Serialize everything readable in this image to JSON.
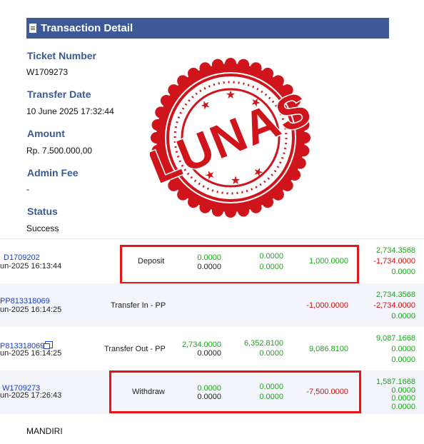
{
  "detail": {
    "title": "Transaction Detail",
    "ticket_label": "Ticket Number",
    "ticket_value": "W1709273",
    "date_label": "Transfer Date",
    "date_value": "10 June 2025 17:32:44",
    "amount_label": "Amount",
    "amount_value": "Rp. 7.500.000,00",
    "fee_label": "Admin Fee",
    "fee_value": "-",
    "status_label": "Status",
    "status_value": "Success"
  },
  "stamp": {
    "text": "LUNAS",
    "color": "#d0141c"
  },
  "rows": [
    {
      "id": "D1709202",
      "date": "un-2025 16:13:44",
      "type": "Deposit",
      "c1": [
        "",
        ""
      ],
      "c2": [
        "0.0000",
        "0.0000"
      ],
      "c3": [
        "0.0000",
        "0.0000"
      ],
      "c4": "1,000.0000",
      "bal": [
        "2,734.3568",
        "-1,734.0000",
        "0.0000"
      ]
    },
    {
      "id": "PP813318069",
      "date": "un-2025 16:14:25",
      "type": "Transfer In - PP",
      "c4": "-1,000.0000",
      "bal": [
        "2,734.3568",
        "-2,734.0000",
        "0.0000"
      ]
    },
    {
      "id": "P813318069",
      "date": "un-2025 16:14:25",
      "type": "Transfer Out - PP",
      "c2": [
        "2,734.0000",
        "0.0000"
      ],
      "c3": [
        "6,352.8100",
        "0.0000"
      ],
      "c4": "9,086.8100",
      "bal": [
        "9,087.1668",
        "0.0000",
        "0.0000"
      ]
    },
    {
      "id": "W1709273",
      "date": "un-2025 17:26:43",
      "type": "Withdraw",
      "c2": [
        "0.0000",
        "0.0000"
      ],
      "c3": [
        "0.0000",
        "0.0000"
      ],
      "c4": "-7,500.0000",
      "bal": [
        "1,587.1668",
        "0.0000",
        "0.0000",
        "0.0000"
      ]
    }
  ],
  "footer": {
    "bank": "MANDIRI"
  },
  "colors": {
    "header_bg": "#3d5a96",
    "label": "#3b5a8f",
    "positive": "#1aa61a",
    "negative": "#d01010",
    "highlight_box": "#e8141a"
  }
}
